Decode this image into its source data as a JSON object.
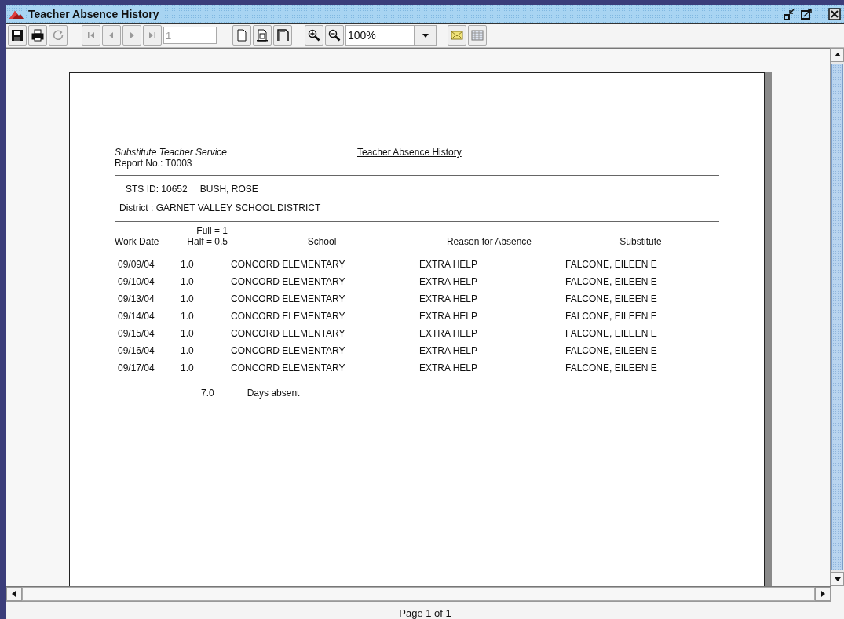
{
  "window": {
    "title": "Teacher Absence History"
  },
  "toolbar": [
    {
      "kind": "save",
      "disabled": false
    },
    {
      "kind": "print",
      "disabled": false
    },
    {
      "kind": "refresh",
      "disabled": true
    },
    {
      "kind": "first",
      "disabled": true
    },
    {
      "kind": "prev",
      "disabled": true
    },
    {
      "kind": "next",
      "disabled": true
    },
    {
      "kind": "last",
      "disabled": true
    }
  ],
  "page_field": {
    "value": "1",
    "disabled": true
  },
  "view_buttons": [
    {
      "kind": "page"
    },
    {
      "kind": "page-width"
    },
    {
      "kind": "whole"
    }
  ],
  "zoom": {
    "value": "100%"
  },
  "export_buttons": [
    {
      "kind": "mail"
    },
    {
      "kind": "table"
    }
  ],
  "report": {
    "organization": "Substitute Teacher Service",
    "report_no": "Report No.: T0003",
    "title": "Teacher Absence History",
    "sts_id": "STS ID: 10652",
    "teacher": "BUSH, ROSE",
    "district": "District : GARNET VALLEY SCHOOL DISTRICT",
    "columns": [
      "Work Date",
      "Full = 1",
      "Half = 0.5",
      "School",
      "Reason for Absence",
      "Substitute"
    ],
    "rows": [
      {
        "date": "09/09/04",
        "amount": "1.0",
        "school": "CONCORD ELEMENTARY",
        "reason": "EXTRA HELP",
        "substitute": "FALCONE, EILEEN E"
      },
      {
        "date": "09/10/04",
        "amount": "1.0",
        "school": "CONCORD ELEMENTARY",
        "reason": "EXTRA HELP",
        "substitute": "FALCONE, EILEEN E"
      },
      {
        "date": "09/13/04",
        "amount": "1.0",
        "school": "CONCORD ELEMENTARY",
        "reason": "EXTRA HELP",
        "substitute": "FALCONE, EILEEN E"
      },
      {
        "date": "09/14/04",
        "amount": "1.0",
        "school": "CONCORD ELEMENTARY",
        "reason": "EXTRA HELP",
        "substitute": "FALCONE, EILEEN E"
      },
      {
        "date": "09/15/04",
        "amount": "1.0",
        "school": "CONCORD ELEMENTARY",
        "reason": "EXTRA HELP",
        "substitute": "FALCONE, EILEEN E"
      },
      {
        "date": "09/16/04",
        "amount": "1.0",
        "school": "CONCORD ELEMENTARY",
        "reason": "EXTRA HELP",
        "substitute": "FALCONE, EILEEN E"
      },
      {
        "date": "09/17/04",
        "amount": "1.0",
        "school": "CONCORD ELEMENTARY",
        "reason": "EXTRA HELP",
        "substitute": "FALCONE, EILEEN E"
      }
    ],
    "total": "7.0",
    "total_label": "Days absent"
  },
  "status_bar": "Page 1 of 1"
}
